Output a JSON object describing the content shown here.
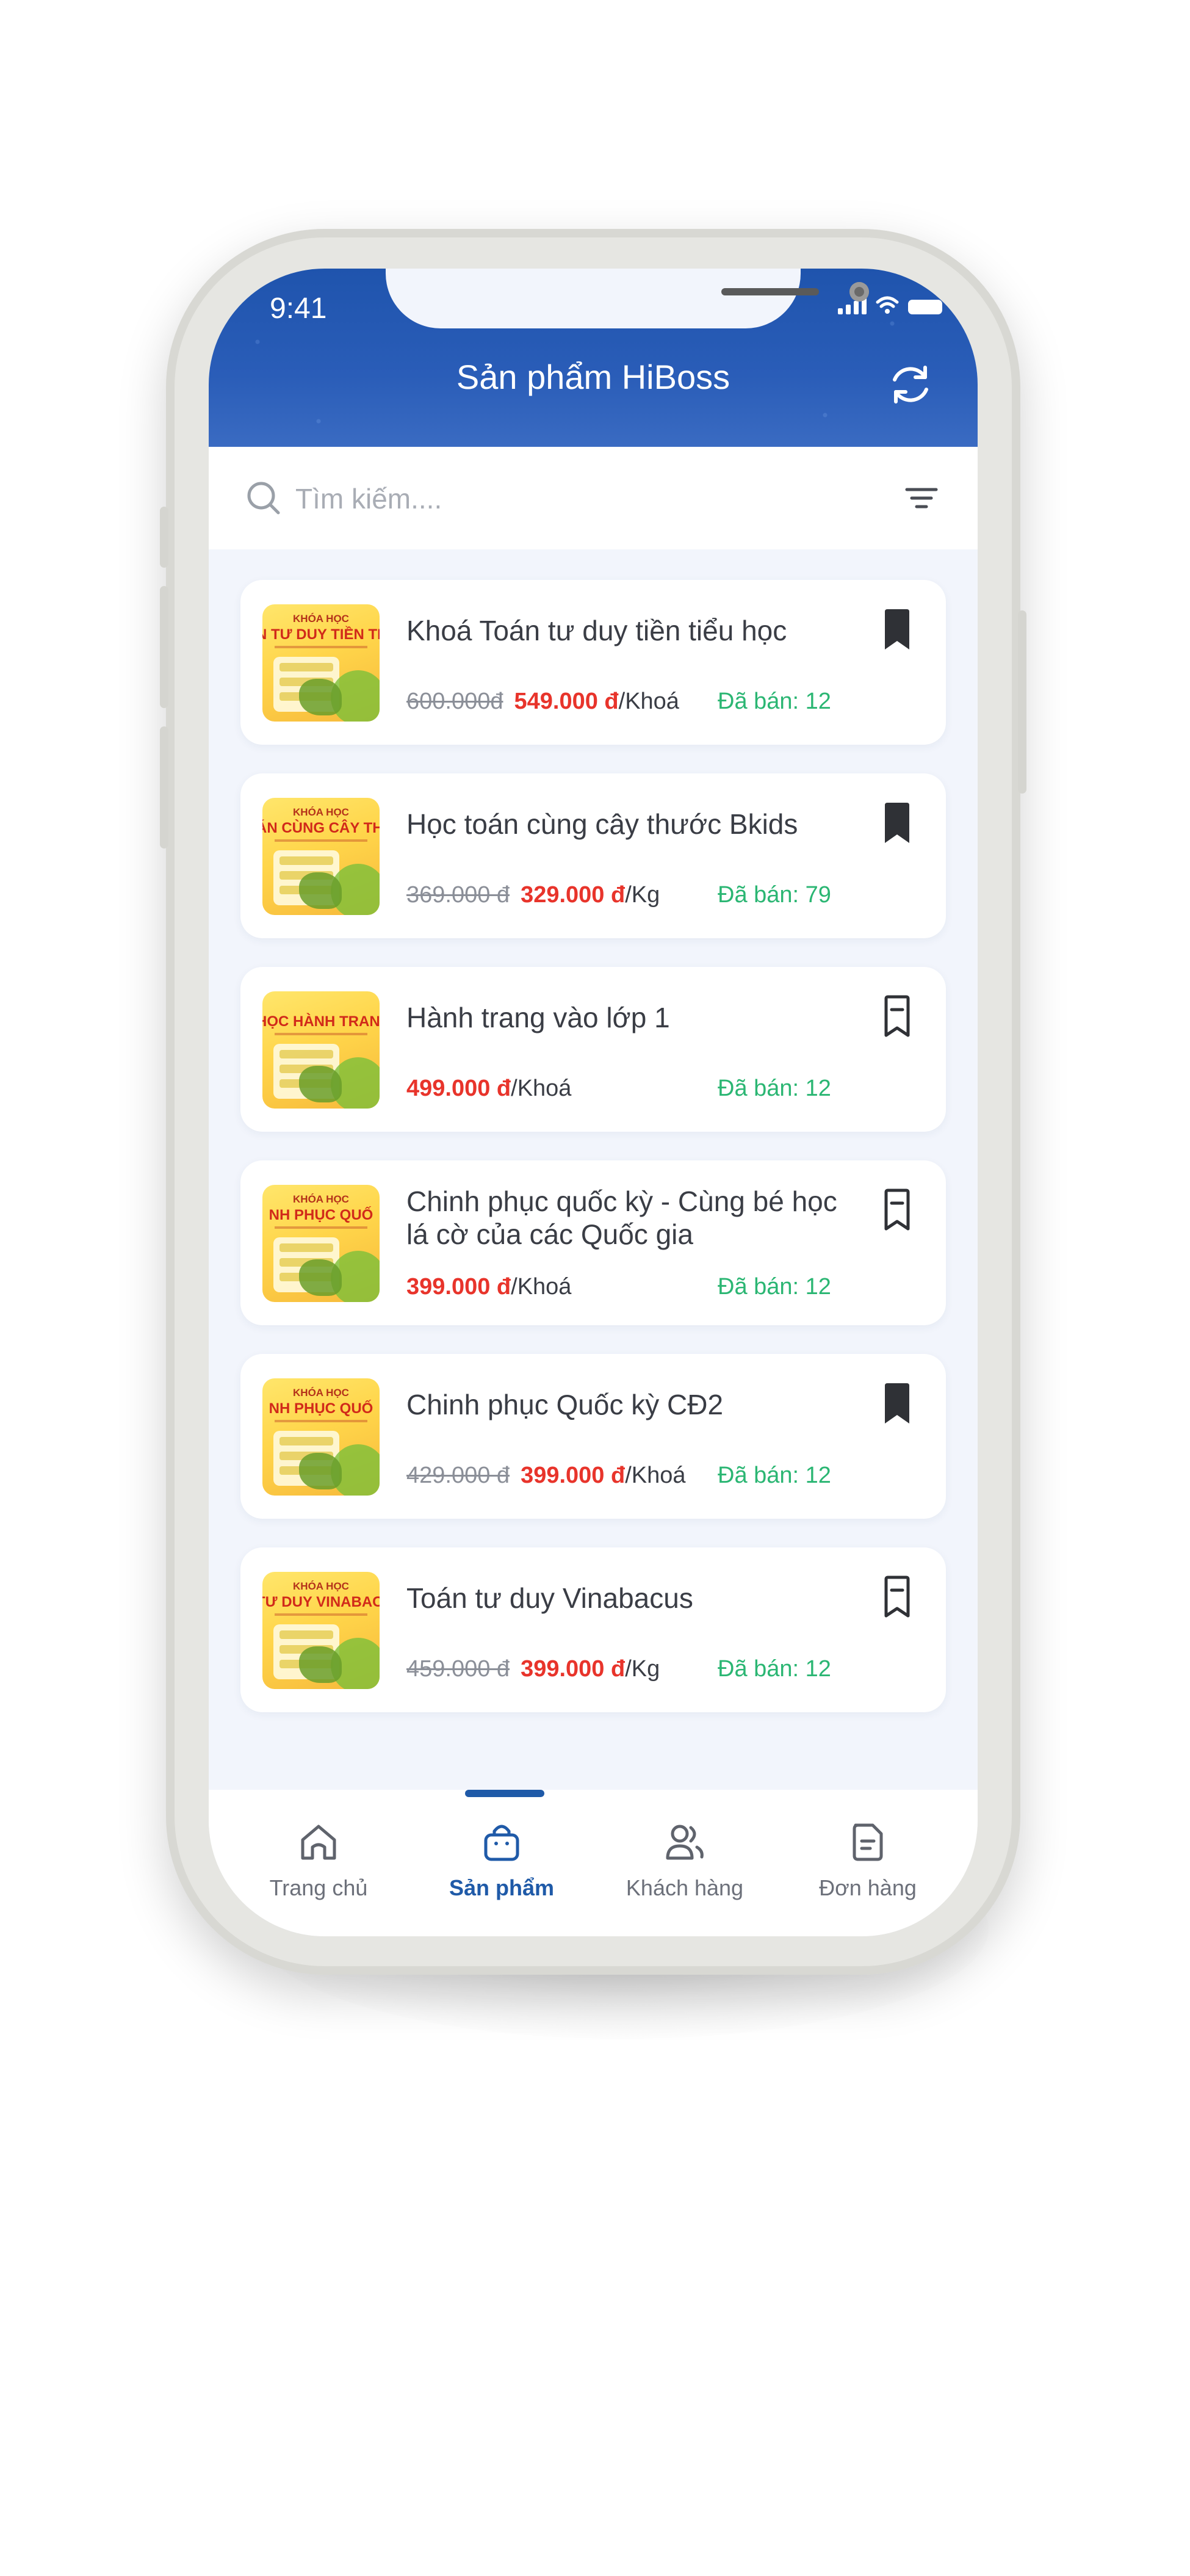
{
  "status": {
    "time": "9:41"
  },
  "header": {
    "title": "Sản phẩm HiBoss",
    "refresh_icon": "refresh-icon"
  },
  "search": {
    "placeholder": "Tìm kiếm....",
    "value": ""
  },
  "colors": {
    "primary": "#1f5aa8",
    "header": "#2a5db8",
    "price": "#e8342b",
    "sold": "#2bb673",
    "background": "#f2f5fc"
  },
  "products": [
    {
      "name": "Khoá Toán tư duy tiền tiểu học",
      "old_price": "600.000đ",
      "price": "549.000 đ",
      "unit": "/Khoá",
      "sold": "Đã bán: 12",
      "bookmarked": true,
      "thumb": {
        "line1": "KHÓA HỌC",
        "line2": "N TƯ DUY TIỀN TIỂU"
      }
    },
    {
      "name": "Học toán cùng cây thước Bkids",
      "old_price": "369.000 đ",
      "price": "329.000 đ",
      "unit": "/Kg",
      "sold": "Đã bán: 79",
      "bookmarked": true,
      "thumb": {
        "line1": "KHÓA HỌC",
        "line2": "ÁN CÙNG CÂY THƯỚ"
      }
    },
    {
      "name": "Hành trang vào lớp 1",
      "old_price": "",
      "price": "499.000 đ",
      "unit": "/Khoá",
      "sold": "Đã bán: 12",
      "bookmarked": false,
      "thumb": {
        "line1": "",
        "line2": "HỌC HÀNH TRANG VÀO"
      }
    },
    {
      "name": "Chinh phục quốc kỳ - Cùng bé học lá cờ của các Quốc gia",
      "old_price": "",
      "price": "399.000 đ",
      "unit": "/Khoá",
      "sold": "Đã bán: 12",
      "bookmarked": false,
      "thumb": {
        "line1": "KHÓA HỌC",
        "line2": "NH PHỤC QUỐ"
      }
    },
    {
      "name": "Chinh phục Quốc kỳ CĐ2",
      "old_price": "429.000 đ",
      "price": "399.000 đ",
      "unit": "/Khoá",
      "sold": "Đã bán: 12",
      "bookmarked": true,
      "thumb": {
        "line1": "KHÓA HỌC",
        "line2": "NH PHỤC QUỐ"
      }
    },
    {
      "name": "Toán tư duy Vinabacus",
      "old_price": "459.000 đ",
      "price": "399.000 đ",
      "unit": "/Kg",
      "sold": "Đã bán: 12",
      "bookmarked": false,
      "thumb": {
        "line1": "KHÓA HỌC",
        "line2": "TƯ DUY VINABACUS"
      }
    }
  ],
  "tabbar": {
    "items": [
      {
        "label": "Trang chủ",
        "icon": "home-icon",
        "active": false
      },
      {
        "label": "Sản phẩm",
        "icon": "shopping-bag-icon",
        "active": true
      },
      {
        "label": "Khách hàng",
        "icon": "users-icon",
        "active": false
      },
      {
        "label": "Đơn hàng",
        "icon": "document-icon",
        "active": false
      }
    ]
  }
}
